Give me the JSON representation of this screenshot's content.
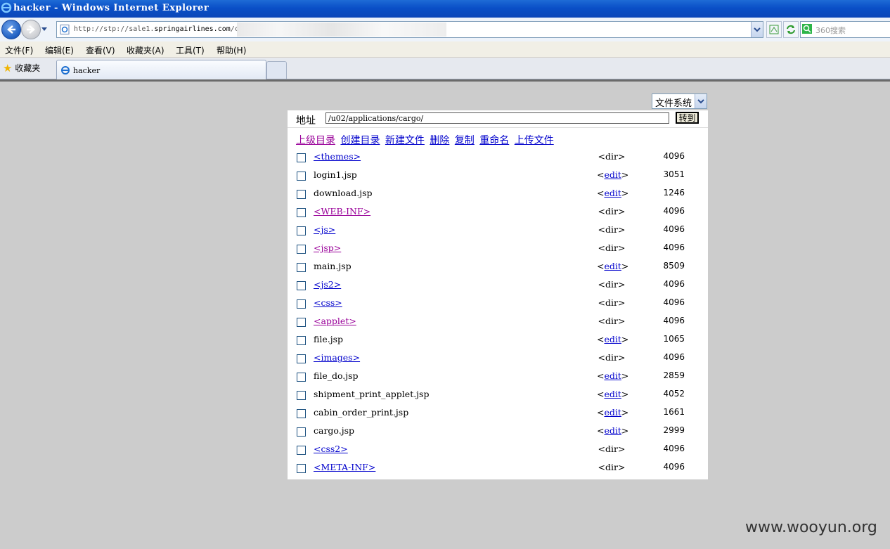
{
  "window": {
    "title": "hacker - Windows Internet Explorer"
  },
  "navbar": {
    "url_prefix": "http://stp://sale1.",
    "url_domain": "springairlines.com",
    "url_suffix": "/c",
    "search_placeholder": "360搜索"
  },
  "menu": [
    "文件(F)",
    "编辑(E)",
    "查看(V)",
    "收藏夹(A)",
    "工具(T)",
    "帮助(H)"
  ],
  "favorites_label": "收藏夹",
  "tab": {
    "label": "hacker"
  },
  "page": {
    "fs_select": "文件系统",
    "address_label": "地址",
    "address_value": "/u02/applications/cargo/",
    "go_button": "转到",
    "actions": [
      "上级目录",
      "创建目录",
      "新建文件",
      "删除",
      "复制",
      "重命名",
      "上传文件"
    ],
    "files": [
      {
        "name": "<themes>",
        "type": "<dir>",
        "size": "4096"
      },
      {
        "name": "login1.jsp",
        "type": "edit",
        "size": "3051"
      },
      {
        "name": "download.jsp",
        "type": "edit",
        "size": "1246"
      },
      {
        "name": "<WEB-INF>",
        "type": "<dir>",
        "size": "4096"
      },
      {
        "name": "<js>",
        "type": "<dir>",
        "size": "4096"
      },
      {
        "name": "<jsp>",
        "type": "<dir>",
        "size": "4096"
      },
      {
        "name": "main.jsp",
        "type": "edit",
        "size": "8509"
      },
      {
        "name": "<js2>",
        "type": "<dir>",
        "size": "4096"
      },
      {
        "name": "<css>",
        "type": "<dir>",
        "size": "4096"
      },
      {
        "name": "<applet>",
        "type": "<dir>",
        "size": "4096"
      },
      {
        "name": "file.jsp",
        "type": "edit",
        "size": "1065"
      },
      {
        "name": "<images>",
        "type": "<dir>",
        "size": "4096"
      },
      {
        "name": "file_do.jsp",
        "type": "edit",
        "size": "2859"
      },
      {
        "name": "shipment_print_applet.jsp",
        "type": "edit",
        "size": "4052"
      },
      {
        "name": "cabin_order_print.jsp",
        "type": "edit",
        "size": "1661"
      },
      {
        "name": "cargo.jsp",
        "type": "edit",
        "size": "2999"
      },
      {
        "name": "<css2>",
        "type": "<dir>",
        "size": "4096"
      },
      {
        "name": "<META-INF>",
        "type": "<dir>",
        "size": "4096"
      }
    ]
  },
  "watermark": "www.wooyun.org"
}
